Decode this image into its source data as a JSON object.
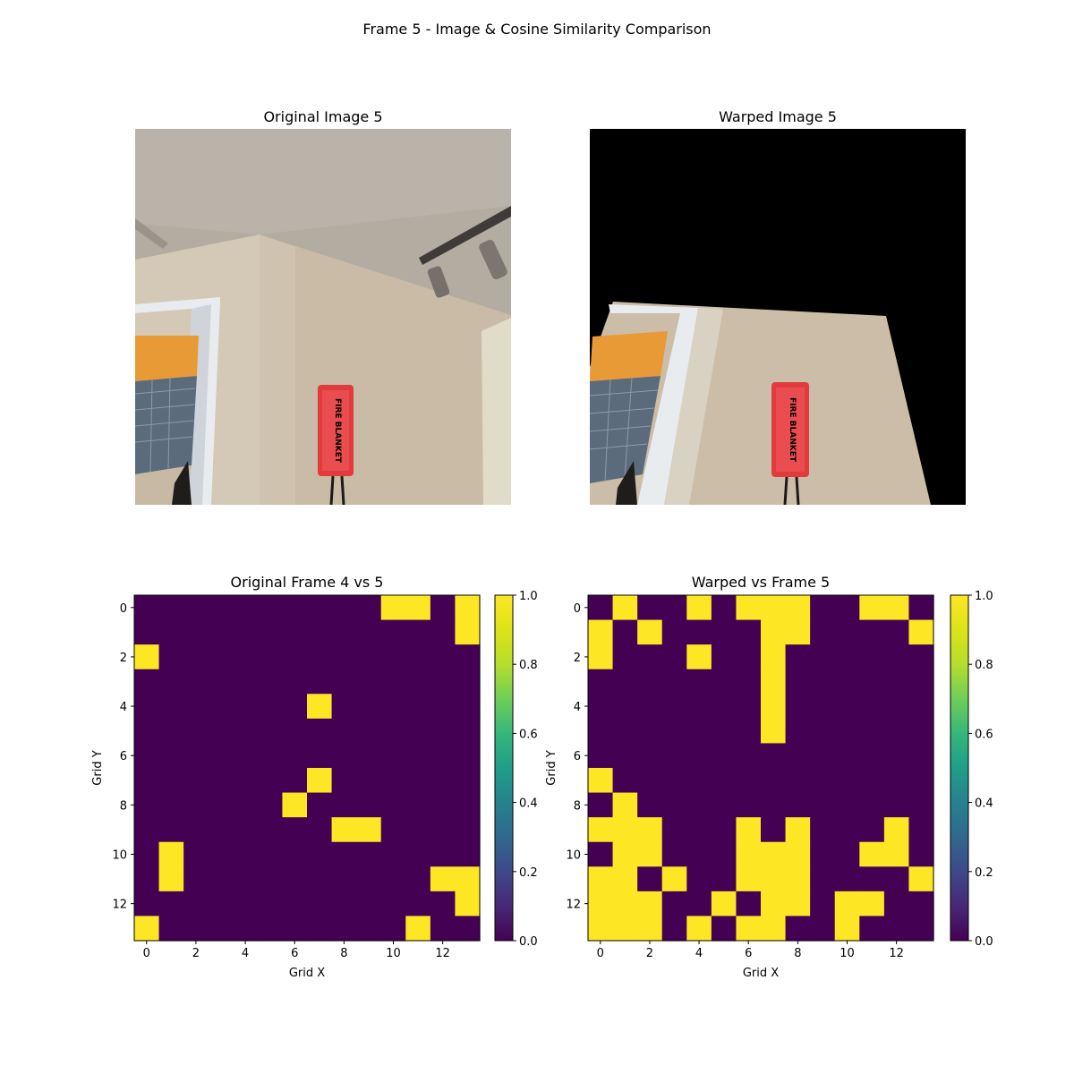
{
  "figure": {
    "suptitle": "Frame 5 - Image & Cosine Similarity Comparison"
  },
  "images": [
    {
      "title": "Original Image 5",
      "palette": {
        "ceiling": "#b5aea3",
        "wall": "#cdc1b0",
        "wall_shadow": "#b8ab98",
        "door_frame": "#e8ebee",
        "orange": "#e89b3a",
        "window": "#5f6f80",
        "sign": "#e8373a",
        "sign_text": "#f3d8d8",
        "fixture": "#6a6661",
        "track": "#3f3c3a"
      },
      "sign_text": "FIRE BLANKET"
    },
    {
      "title": "Warped Image 5",
      "palette": {
        "background": "#000000",
        "wall": "#cdc1b0",
        "door_frame": "#e8ebee",
        "orange": "#e89b3a",
        "window": "#5f6f80",
        "sign": "#e8373a",
        "sign_text": "#f3d8d8"
      },
      "sign_text": "FIRE BLANKET"
    }
  ],
  "chart_data": [
    {
      "type": "heatmap",
      "title": "Original Frame 4 vs 5",
      "xlabel": "Grid X",
      "ylabel": "Grid Y",
      "xticks": [
        0,
        2,
        4,
        6,
        8,
        10,
        12
      ],
      "yticks": [
        0,
        2,
        4,
        6,
        8,
        10,
        12
      ],
      "colormap": "viridis",
      "vmin": 0.0,
      "vmax": 1.0,
      "colorbar_ticks": [
        "0.0",
        "0.2",
        "0.4",
        "0.6",
        "0.8",
        "1.0"
      ],
      "values": [
        [
          0,
          0,
          0,
          0,
          0,
          0,
          0,
          0,
          0,
          0,
          1,
          1,
          0,
          1
        ],
        [
          0,
          0,
          0,
          0,
          0,
          0,
          0,
          0,
          0,
          0,
          0,
          0,
          0,
          1
        ],
        [
          1,
          0,
          0,
          0,
          0,
          0,
          0,
          0,
          0,
          0,
          0,
          0,
          0,
          0
        ],
        [
          0,
          0,
          0,
          0,
          0,
          0,
          0,
          0,
          0,
          0,
          0,
          0,
          0,
          0
        ],
        [
          0,
          0,
          0,
          0,
          0,
          0,
          0,
          1,
          0,
          0,
          0,
          0,
          0,
          0
        ],
        [
          0,
          0,
          0,
          0,
          0,
          0,
          0,
          0,
          0,
          0,
          0,
          0,
          0,
          0
        ],
        [
          0,
          0,
          0,
          0,
          0,
          0,
          0,
          0,
          0,
          0,
          0,
          0,
          0,
          0
        ],
        [
          0,
          0,
          0,
          0,
          0,
          0,
          0,
          1,
          0,
          0,
          0,
          0,
          0,
          0
        ],
        [
          0,
          0,
          0,
          0,
          0,
          0,
          1,
          0,
          0,
          0,
          0,
          0,
          0,
          0
        ],
        [
          0,
          0,
          0,
          0,
          0,
          0,
          0,
          0,
          1,
          1,
          0,
          0,
          0,
          0
        ],
        [
          0,
          1,
          0,
          0,
          0,
          0,
          0,
          0,
          0,
          0,
          0,
          0,
          0,
          0
        ],
        [
          0,
          1,
          0,
          0,
          0,
          0,
          0,
          0,
          0,
          0,
          0,
          0,
          1,
          1
        ],
        [
          0,
          0,
          0,
          0,
          0,
          0,
          0,
          0,
          0,
          0,
          0,
          0,
          0,
          1
        ],
        [
          1,
          0,
          0,
          0,
          0,
          0,
          0,
          0,
          0,
          0,
          0,
          1,
          0,
          0
        ]
      ]
    },
    {
      "type": "heatmap",
      "title": "Warped vs Frame 5",
      "xlabel": "Grid X",
      "ylabel": "Grid Y",
      "xticks": [
        0,
        2,
        4,
        6,
        8,
        10,
        12
      ],
      "yticks": [
        0,
        2,
        4,
        6,
        8,
        10,
        12
      ],
      "colormap": "viridis",
      "vmin": 0.0,
      "vmax": 1.0,
      "colorbar_ticks": [
        "0.0",
        "0.2",
        "0.4",
        "0.6",
        "0.8",
        "1.0"
      ],
      "values": [
        [
          0,
          1,
          0,
          0,
          1,
          0,
          1,
          1,
          1,
          0,
          0,
          1,
          1,
          0
        ],
        [
          1,
          0,
          1,
          0,
          0,
          0,
          0,
          1,
          1,
          0,
          0,
          0,
          0,
          1
        ],
        [
          1,
          0,
          0,
          0,
          1,
          0,
          0,
          1,
          0,
          0,
          0,
          0,
          0,
          0
        ],
        [
          0,
          0,
          0,
          0,
          0,
          0,
          0,
          1,
          0,
          0,
          0,
          0,
          0,
          0
        ],
        [
          0,
          0,
          0,
          0,
          0,
          0,
          0,
          1,
          0,
          0,
          0,
          0,
          0,
          0
        ],
        [
          0,
          0,
          0,
          0,
          0,
          0,
          0,
          1,
          0,
          0,
          0,
          0,
          0,
          0
        ],
        [
          0,
          0,
          0,
          0,
          0,
          0,
          0,
          0,
          0,
          0,
          0,
          0,
          0,
          0
        ],
        [
          1,
          0,
          0,
          0,
          0,
          0,
          0,
          0,
          0,
          0,
          0,
          0,
          0,
          0
        ],
        [
          0,
          1,
          0,
          0,
          0,
          0,
          0,
          0,
          0,
          0,
          0,
          0,
          0,
          0
        ],
        [
          1,
          1,
          1,
          0,
          0,
          0,
          1,
          0,
          1,
          0,
          0,
          0,
          1,
          0
        ],
        [
          0,
          1,
          1,
          0,
          0,
          0,
          1,
          1,
          1,
          0,
          0,
          1,
          1,
          0
        ],
        [
          1,
          1,
          0,
          1,
          0,
          0,
          1,
          1,
          1,
          0,
          0,
          0,
          0,
          1
        ],
        [
          1,
          1,
          1,
          0,
          0,
          1,
          0,
          1,
          1,
          0,
          1,
          1,
          0,
          0
        ],
        [
          1,
          1,
          1,
          0,
          1,
          0,
          1,
          1,
          0,
          0,
          1,
          0,
          0,
          0
        ]
      ]
    }
  ]
}
